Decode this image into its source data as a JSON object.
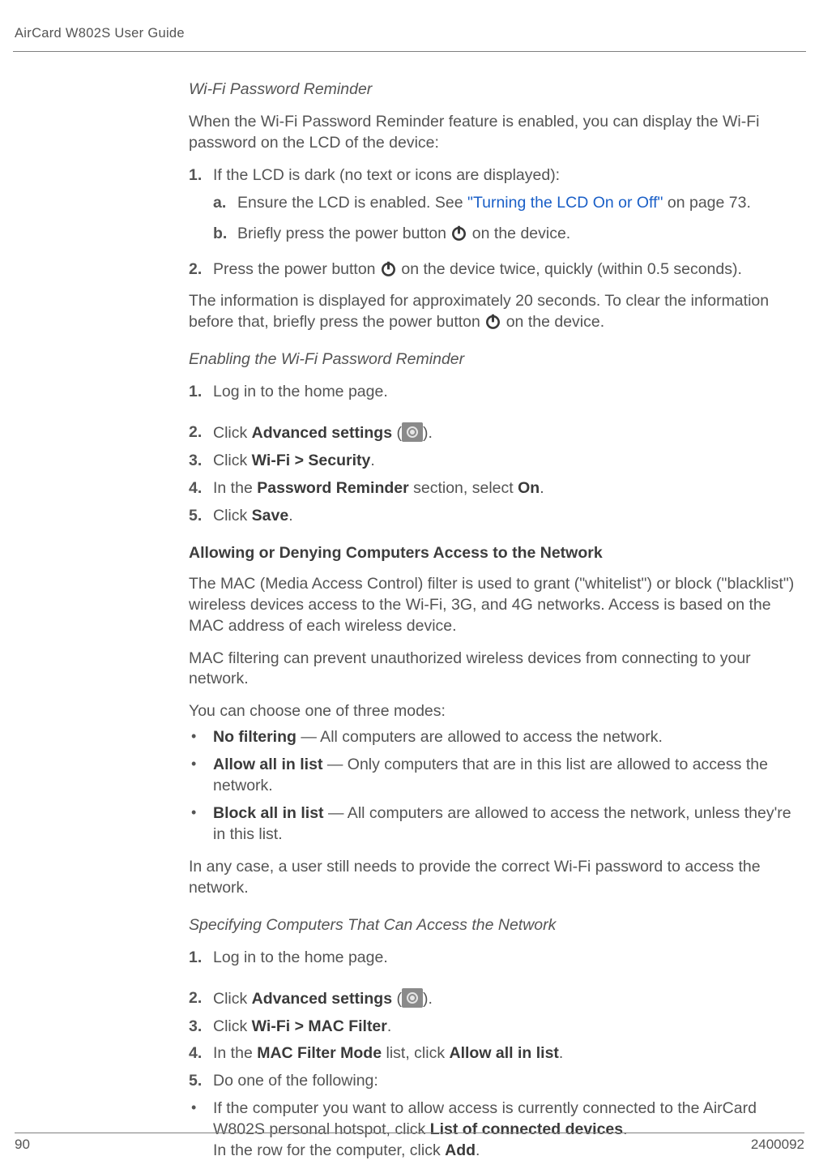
{
  "header": {
    "title": "AirCard W802S User Guide"
  },
  "sec1": {
    "subhead": "Wi-Fi Password Reminder",
    "intro": "When the Wi-Fi Password Reminder feature is enabled, you can display the Wi-Fi password on the LCD of the device:",
    "s1_num": "1.",
    "s1_text": "If the LCD is dark (no text or icons are displayed):",
    "s1a_num": "a.",
    "s1a_pre": "Ensure the LCD is enabled. See ",
    "s1a_link": "\"Turning the LCD On or Off\"",
    "s1a_post": " on page 73.",
    "s1b_num": "b.",
    "s1b_pre": "Briefly press the power button ",
    "s1b_post": " on the device.",
    "s2_num": "2.",
    "s2_pre": "Press the power button ",
    "s2_post": " on the device twice, quickly (within 0.5 seconds).",
    "note_pre": "The information is displayed for approximately 20 seconds. To clear the information before that, briefly press the power button ",
    "note_post": " on the device."
  },
  "sec2": {
    "subhead": "Enabling the Wi-Fi Password Reminder",
    "s1_num": "1.",
    "s1_text": "Log in to the home page.",
    "s2_num": "2.",
    "s2_pre": "Click ",
    "s2_bold": "Advanced settings",
    "s2_mid": " (",
    "s2_end": ").",
    "s3_num": "3.",
    "s3_pre": "Click ",
    "s3_bold": "Wi-Fi > Security",
    "s3_end": ".",
    "s4_num": "4.",
    "s4_pre": "In the ",
    "s4_bold1": "Password Reminder",
    "s4_mid": " section, select ",
    "s4_bold2": "On",
    "s4_end": ".",
    "s5_num": "5.",
    "s5_pre": "Click ",
    "s5_bold": "Save",
    "s5_end": "."
  },
  "sec3": {
    "head": "Allowing or Denying Computers Access to the Network",
    "p1": "The MAC (Media Access Control) filter is used to grant (\"whitelist\") or block (\"blacklist\") wireless devices access to the Wi-Fi, 3G, and 4G networks. Access is based on the MAC address of each wireless device.",
    "p2": "MAC filtering can prevent unauthorized wireless devices from connecting to your network.",
    "p3": "You can choose one of three modes:",
    "b1_bold": "No filtering",
    "b1_text": " — All computers are allowed to access the network.",
    "b2_bold": "Allow all in list",
    "b2_text": " — Only computers that are in this list are allowed to access the network.",
    "b3_bold": "Block all in list",
    "b3_text": " — All computers are allowed to access the network, unless they're in this list.",
    "p4": "In any case, a user still needs to provide the correct Wi-Fi password to access the network."
  },
  "sec4": {
    "subhead": "Specifying Computers That Can Access the Network",
    "s1_num": "1.",
    "s1_text": "Log in to the home page.",
    "s2_num": "2.",
    "s2_pre": "Click ",
    "s2_bold": "Advanced settings",
    "s2_mid": " (",
    "s2_end": ").",
    "s3_num": "3.",
    "s3_pre": "Click ",
    "s3_bold": "Wi-Fi > MAC Filter",
    "s3_end": ".",
    "s4_num": "4.",
    "s4_pre": "In the ",
    "s4_bold1": "MAC Filter Mode",
    "s4_mid": " list, click ",
    "s4_bold2": "Allow all in list",
    "s4_end": ".",
    "s5_num": "5.",
    "s5_text": "Do one of the following:",
    "b1_pre": "If the computer you want to allow access is currently connected to the AirCard W802S personal hotspot, click ",
    "b1_bold1": "List of connected devices",
    "b1_mid": ".",
    "b1_line2_pre": "In the row for the computer, click ",
    "b1_bold2": "Add",
    "b1_line2_end": "."
  },
  "footer": {
    "page": "90",
    "docid": "2400092"
  }
}
